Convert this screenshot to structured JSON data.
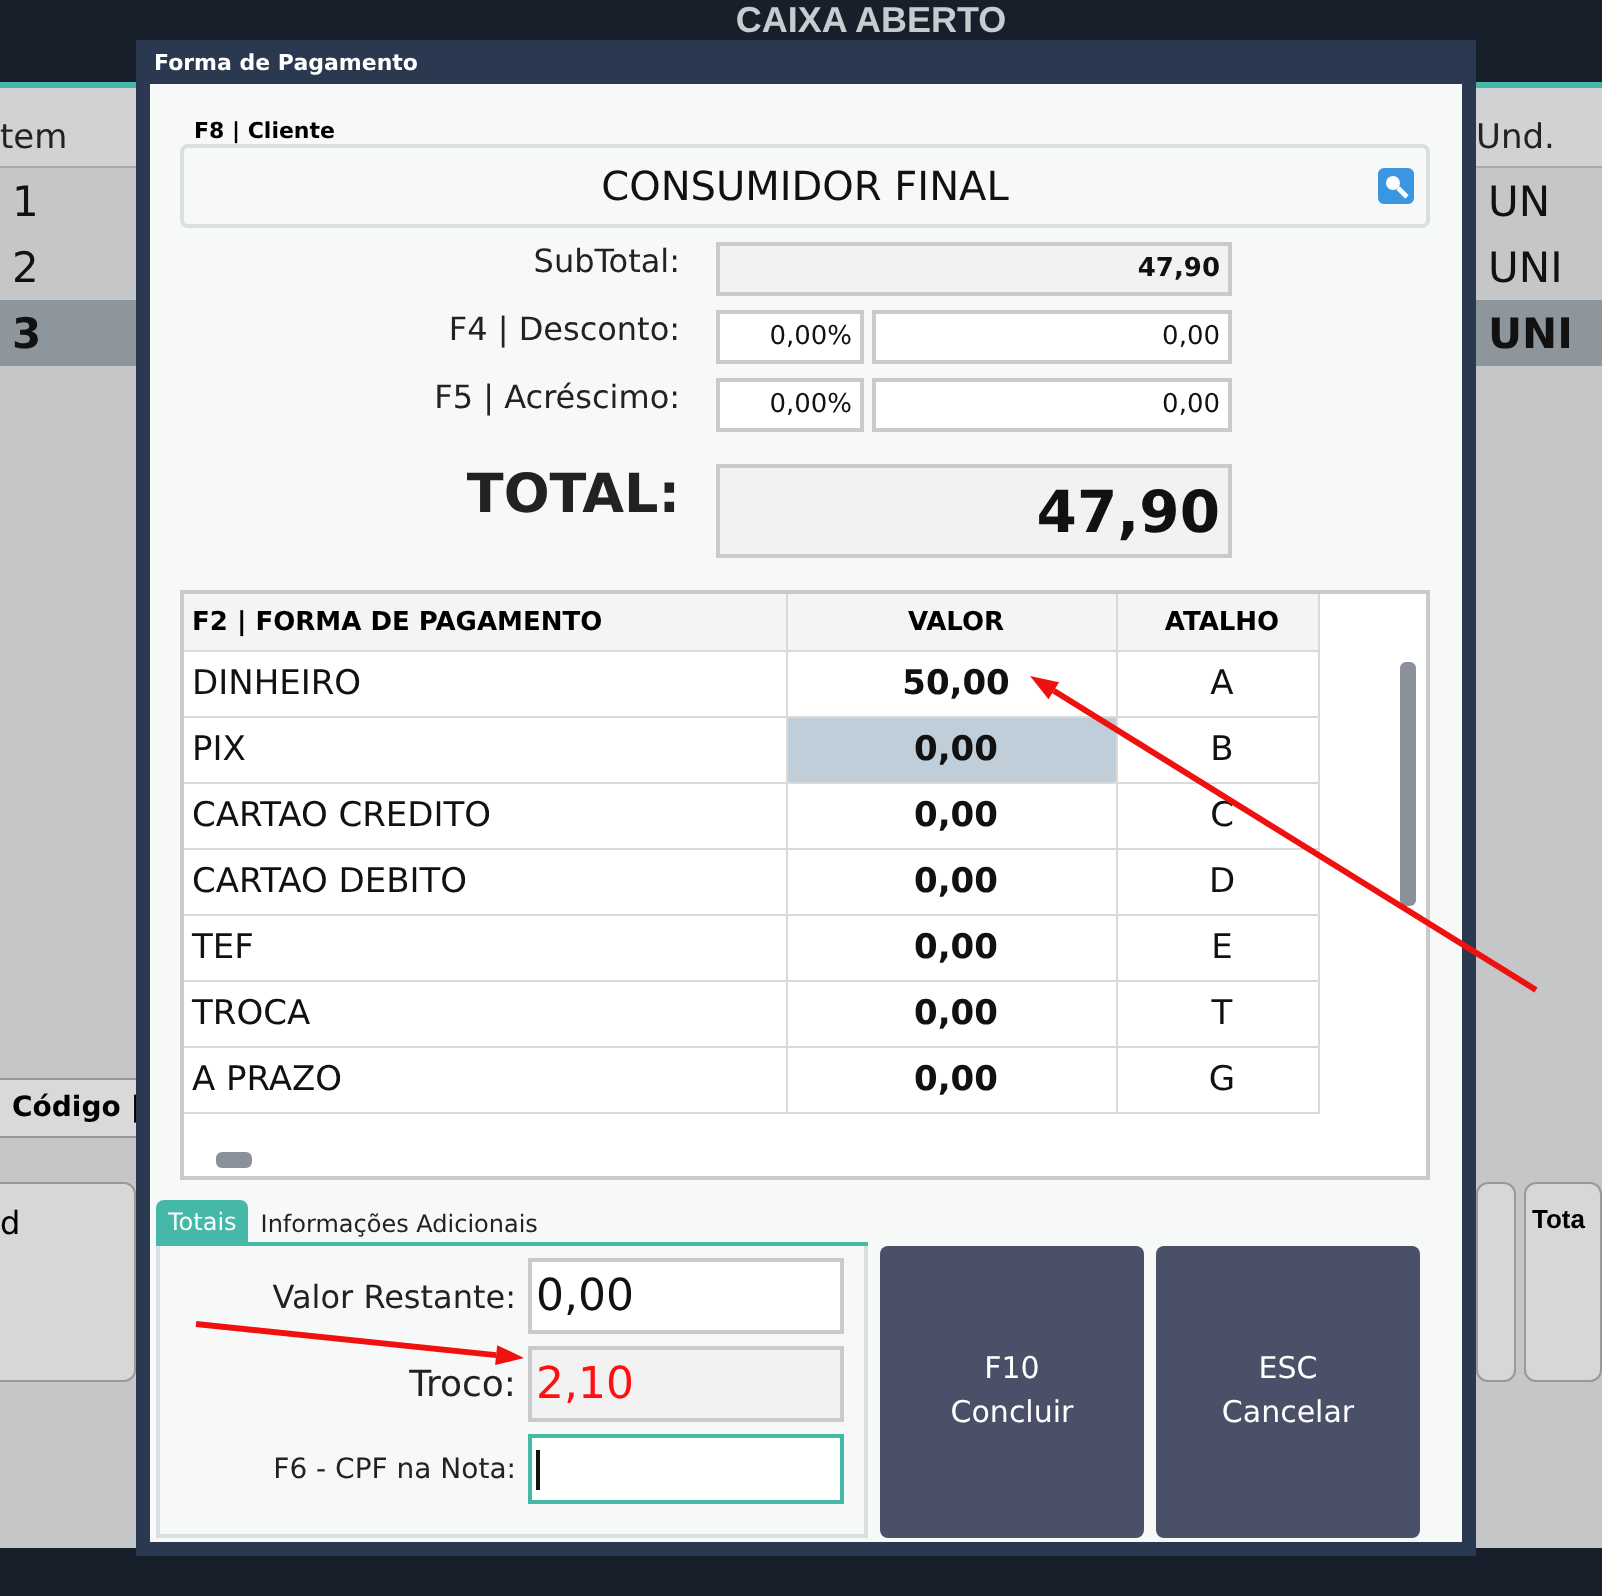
{
  "background": {
    "title": "CAIXA ABERTO",
    "left_column": {
      "header": "tem",
      "rows": [
        {
          "text": "1",
          "selected": false
        },
        {
          "text": "2",
          "selected": false
        },
        {
          "text": "3",
          "selected": true
        }
      ]
    },
    "right_column": {
      "header": "Und.",
      "rows": [
        {
          "text": "UN",
          "selected": false
        },
        {
          "text": "UNI",
          "selected": false
        },
        {
          "text": "UNI",
          "selected": true
        }
      ]
    },
    "lower_header": "Código |",
    "lower_left_label": "d",
    "lower_right_label": "Tota"
  },
  "dialog": {
    "title": "Forma de Pagamento",
    "client": {
      "legend": "F8 | Cliente",
      "value": "CONSUMIDOR FINAL"
    },
    "subtotal": {
      "label": "SubTotal:",
      "value": "47,90"
    },
    "discount": {
      "label": "F4 | Desconto:",
      "percent": "0,00%",
      "value": "0,00"
    },
    "surcharge": {
      "label": "F5 | Acréscimo:",
      "percent": "0,00%",
      "value": "0,00"
    },
    "total": {
      "label": "TOTAL:",
      "value": "47,90"
    },
    "payments": {
      "columns": [
        "F2 | FORMA DE PAGAMENTO",
        "VALOR",
        "ATALHO"
      ],
      "rows": [
        {
          "name": "DINHEIRO",
          "value": "50,00",
          "shortcut": "A",
          "selected": false
        },
        {
          "name": "PIX",
          "value": "0,00",
          "shortcut": "B",
          "selected": true
        },
        {
          "name": "CARTAO CREDITO",
          "value": "0,00",
          "shortcut": "C",
          "selected": false
        },
        {
          "name": "CARTAO DEBITO",
          "value": "0,00",
          "shortcut": "D",
          "selected": false
        },
        {
          "name": "TEF",
          "value": "0,00",
          "shortcut": "E",
          "selected": false
        },
        {
          "name": "TROCA",
          "value": "0,00",
          "shortcut": "T",
          "selected": false
        },
        {
          "name": "A PRAZO",
          "value": "0,00",
          "shortcut": "G",
          "selected": false
        }
      ]
    },
    "tabs": [
      {
        "label": "Totais",
        "selected": true
      },
      {
        "label": "Informações Adicionais",
        "selected": false
      }
    ],
    "remaining": {
      "label": "Valor Restante:",
      "value": "0,00"
    },
    "change": {
      "label": "Troco:",
      "value": "2,10"
    },
    "cpf": {
      "label": "F6 - CPF na Nota:",
      "focused": true
    },
    "buttons": [
      {
        "key": "F10",
        "label": "Concluir"
      },
      {
        "key": "ESC",
        "label": "Cancelar"
      }
    ]
  }
}
